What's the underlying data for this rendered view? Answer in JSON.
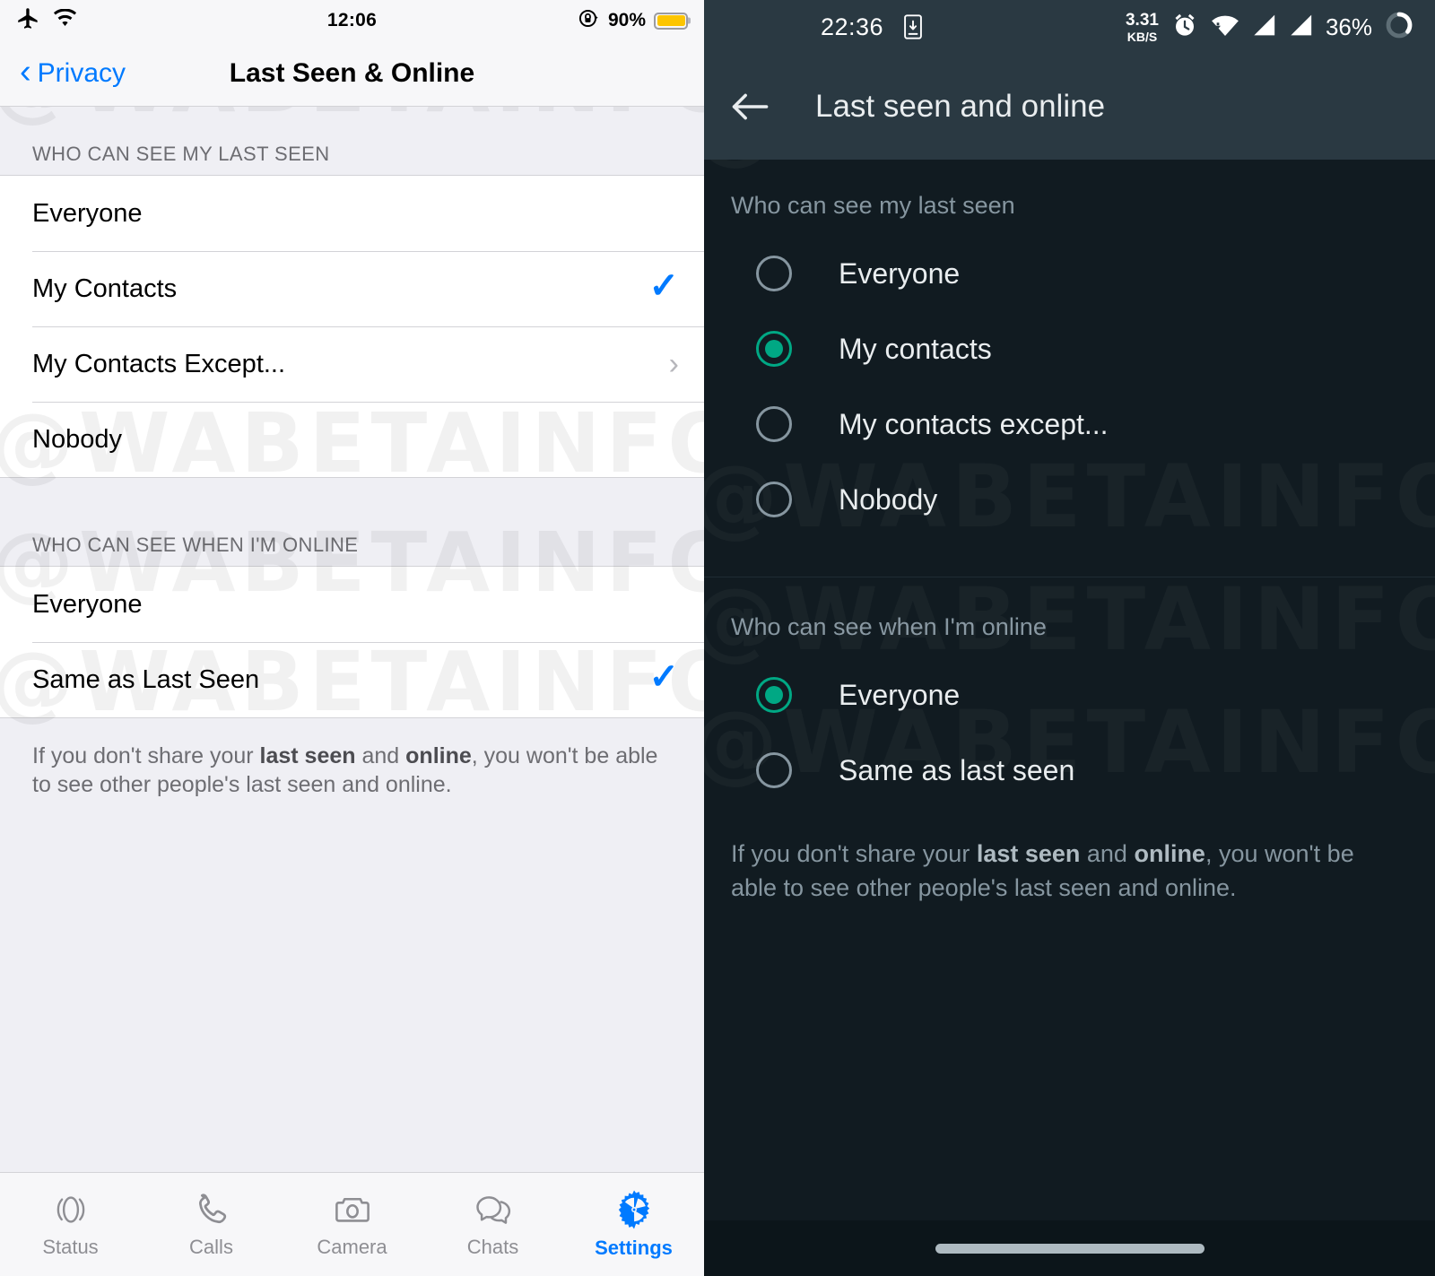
{
  "ios": {
    "status_bar": {
      "airplane_icon": "airplane-icon",
      "wifi_icon": "wifi-icon",
      "time": "12:06",
      "rotation_lock_icon": "rotation-lock-icon",
      "battery_percent": "90%",
      "battery_icon": "battery-icon",
      "battery_color": "#fdc500"
    },
    "nav": {
      "back_label": "Privacy",
      "back_icon": "chevron-left-icon",
      "title": "Last Seen & Online",
      "accent_color": "#007aff"
    },
    "sections": [
      {
        "header": "WHO CAN SEE MY LAST SEEN",
        "rows": [
          {
            "label": "Everyone",
            "accessory": "none"
          },
          {
            "label": "My Contacts",
            "accessory": "check"
          },
          {
            "label": "My Contacts Except...",
            "accessory": "chevron"
          },
          {
            "label": "Nobody",
            "accessory": "none"
          }
        ]
      },
      {
        "header": "WHO CAN SEE WHEN I'M ONLINE",
        "rows": [
          {
            "label": "Everyone",
            "accessory": "none"
          },
          {
            "label": "Same as Last Seen",
            "accessory": "check"
          }
        ]
      }
    ],
    "footnote": {
      "part1": "If you don't share your ",
      "bold1": "last seen",
      "part2": " and ",
      "bold2": "online",
      "part3": ", you won't be able to see other people's last seen and online."
    },
    "tabs": [
      {
        "label": "Status",
        "icon": "status-rings-icon",
        "active": false
      },
      {
        "label": "Calls",
        "icon": "phone-icon",
        "active": false
      },
      {
        "label": "Camera",
        "icon": "camera-icon",
        "active": false
      },
      {
        "label": "Chats",
        "icon": "chat-bubbles-icon",
        "active": false
      },
      {
        "label": "Settings",
        "icon": "gear-icon",
        "active": true
      }
    ]
  },
  "android": {
    "status_bar": {
      "time": "22:36",
      "device_icon": "phone-download-icon",
      "data_rate_value": "3.31",
      "data_rate_unit": "KB/S",
      "alarm_icon": "alarm-clock-icon",
      "wifi_icon": "wifi-download-icon",
      "signal_icon_1": "signal-bars-icon",
      "signal_icon_2": "signal-bars-icon",
      "battery_percent": "36%",
      "battery_icon": "battery-ring-icon"
    },
    "appbar": {
      "back_icon": "arrow-left-icon",
      "title": "Last seen and online"
    },
    "sections": [
      {
        "header": "Who can see my last seen",
        "options": [
          {
            "label": "Everyone",
            "selected": false
          },
          {
            "label": "My contacts",
            "selected": true
          },
          {
            "label": "My contacts except...",
            "selected": false
          },
          {
            "label": "Nobody",
            "selected": false
          }
        ]
      },
      {
        "header": "Who can see when I'm online",
        "options": [
          {
            "label": "Everyone",
            "selected": true
          },
          {
            "label": "Same as last seen",
            "selected": false
          }
        ]
      }
    ],
    "footnote": {
      "part1": "If you don't share your ",
      "bold1": "last seen",
      "part2": " and ",
      "bold2": "online",
      "part3": ", you won't be able to see other people's last seen and online."
    },
    "nav_pill": "home-pill-indicator",
    "accent_color": "#00a884"
  },
  "watermark": {
    "text": "@WABETAINFO"
  }
}
